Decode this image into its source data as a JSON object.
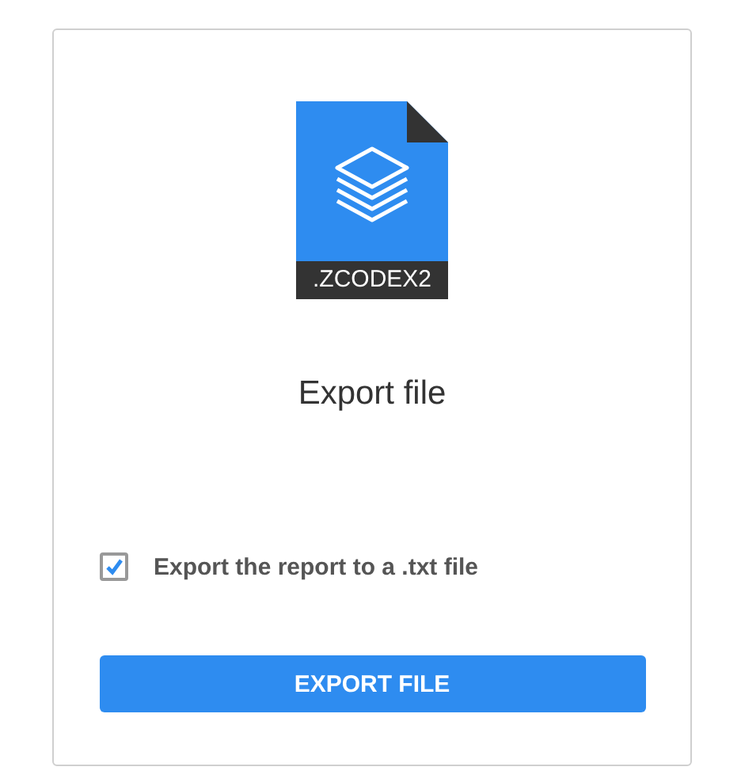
{
  "file_icon": {
    "extension": ".ZCODEX2"
  },
  "title": "Export file",
  "option": {
    "label": "Export the report to a .txt file",
    "checked": true
  },
  "button": "EXPORT FILE"
}
